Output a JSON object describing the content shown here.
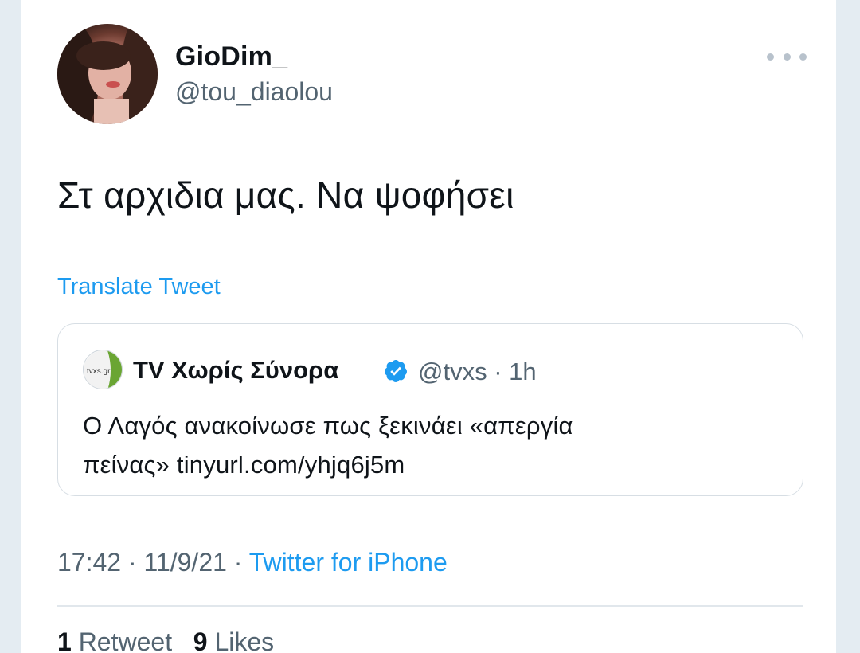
{
  "tweet": {
    "author": {
      "display_name": "GioDim_",
      "handle": "@tou_diaolou"
    },
    "text": "Στ αρχιδια μας. Να ψοφήσει",
    "translate_label": "Translate Tweet",
    "quoted": {
      "avatar_text": "tvxs.gr",
      "display_name": "TV Χωρίς Σύνορα",
      "verified": true,
      "handle": "@tvxs",
      "separator": "·",
      "time": "1h",
      "text_line1": "Ο Λαγός ανακοίνωσε πως ξεκινάει «απεργία",
      "text_line2": "πείνας» tinyurl.com/yhjq6j5m"
    },
    "timestamp": "17:42 · 11/9/21 ·",
    "source": "Twitter for iPhone",
    "stats": {
      "retweets_count": "1",
      "retweets_label": "Retweet",
      "likes_count": "9",
      "likes_label": "Likes"
    }
  },
  "colors": {
    "accent": "#1d9bf0",
    "secondary_text": "#536471",
    "primary_text": "#0f1419"
  },
  "icons": {
    "more": "more-horizontal-icon",
    "verified": "verified-badge-icon"
  }
}
